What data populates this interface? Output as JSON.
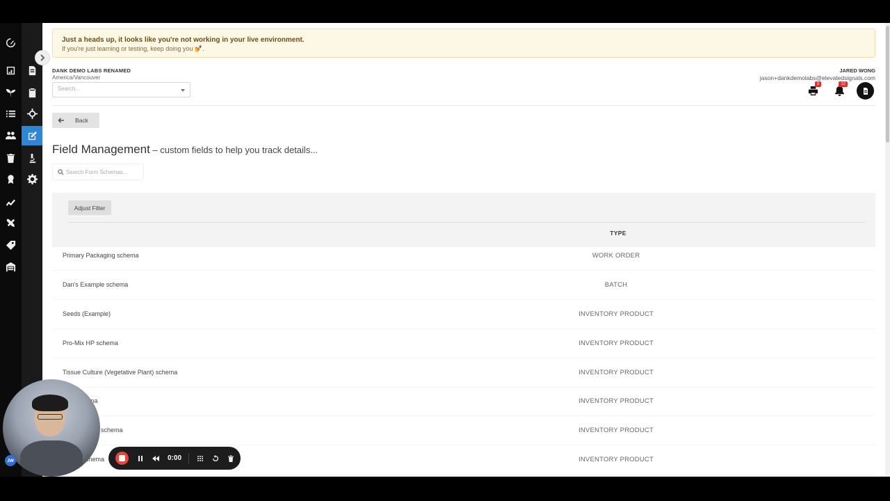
{
  "banner": {
    "title": "Just a heads up, it looks like you're not working in your live environment.",
    "subtitle": "If you're just learning or testing, keep doing you 💅."
  },
  "org": {
    "name": "DANK DEMO LABS RENAMED",
    "timezone": "America/Vancouver",
    "search_placeholder": "Search..."
  },
  "user": {
    "name": "JARED WONG",
    "email": "jason+dankdemolabs@elevatedsignals.com",
    "print_badge": "3",
    "notification_badge": "12"
  },
  "back_label": "Back",
  "page": {
    "title": "Field Management",
    "subtitle": " – custom fields to help you track details...",
    "search_placeholder": "Search Form Schemas...",
    "adjust_filter_label": "Adjust Filter",
    "type_column_header": "TYPE"
  },
  "rows": [
    {
      "name": "Primary Packaging schema",
      "type": "WORK ORDER"
    },
    {
      "name": "Dan's Example schema",
      "type": "BATCH"
    },
    {
      "name": "Seeds (Example)",
      "type": "INVENTORY PRODUCT"
    },
    {
      "name": "Pro-Mix HP schema",
      "type": "INVENTORY PRODUCT"
    },
    {
      "name": "Tissue Culture (Vegetative Plant) schema",
      "type": "INVENTORY PRODUCT"
    },
    {
      "name": "ema",
      "type": "INVENTORY PRODUCT"
    },
    {
      "name": "mple schema",
      "type": "INVENTORY PRODUCT"
    },
    {
      "name": "chema",
      "type": "INVENTORY PRODUCT"
    }
  ],
  "recorder": {
    "time": "0:00",
    "avatar_initials": "JW"
  },
  "sidebar": {
    "active_item": "edit-icon",
    "accent_color": "#2f86d6"
  }
}
